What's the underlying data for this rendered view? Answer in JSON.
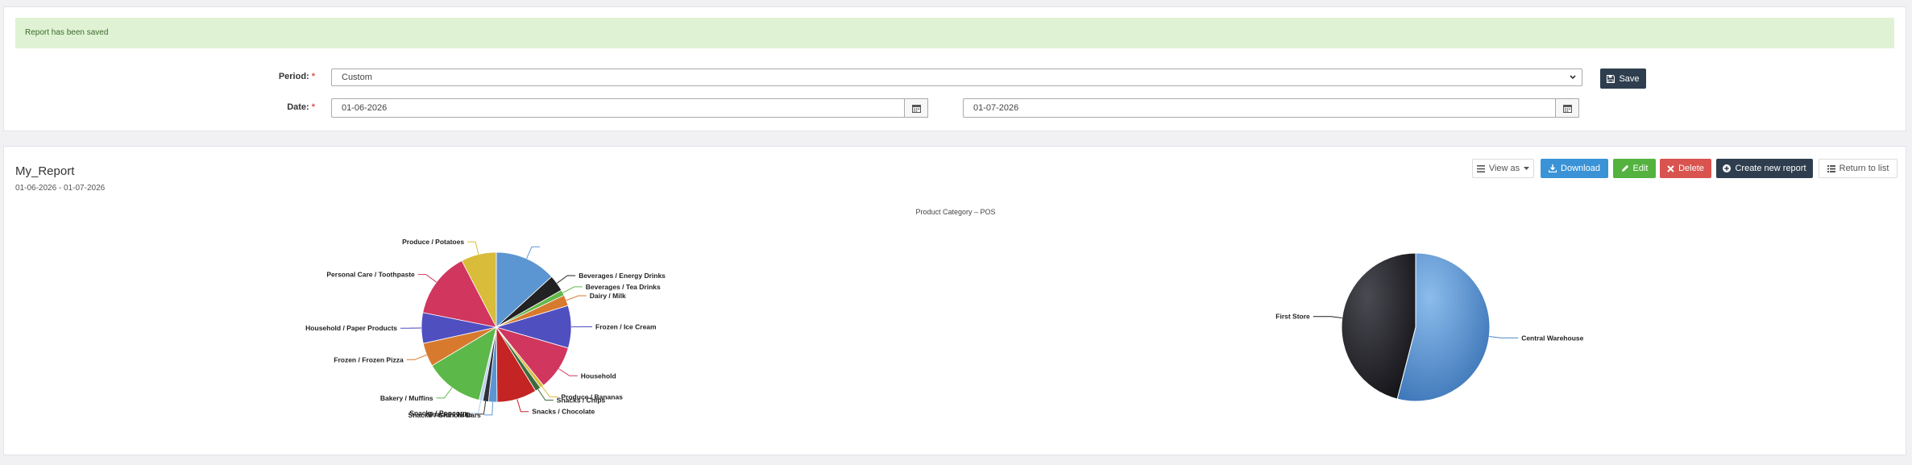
{
  "alert": {
    "message": "Report has been saved"
  },
  "form": {
    "period_label": "Period:",
    "period_value": "Custom",
    "date_label": "Date:",
    "required_mark": "*",
    "date_from": "01-06-2026",
    "date_to": "01-07-2026",
    "save_label": "Save"
  },
  "report": {
    "title": "My_Report",
    "date_range": "01-06-2026 - 01-07-2026",
    "toolbar": {
      "view_as": "View as",
      "download": "Download",
      "edit": "Edit",
      "delete": "Delete",
      "create_new": "Create new report",
      "return_to_list": "Return to list"
    },
    "chart_caption": "Product Category – POS"
  },
  "colors": {
    "alert_bg": "#dff3d4",
    "primary_dark": "#2e3e4e",
    "download_blue": "#3a93d6",
    "edit_green": "#53b33e",
    "delete_red": "#d9534f"
  },
  "chart_data": [
    {
      "type": "pie",
      "slices": [
        {
          "label": "",
          "value": 13.0,
          "color": "#5b95d2"
        },
        {
          "label": "Beverages / Energy Drinks",
          "value": 3.5,
          "color": "#222222"
        },
        {
          "label": "Beverages / Tea Drinks",
          "value": 1.2,
          "color": "#62b84a"
        },
        {
          "label": "Dairy / Milk",
          "value": 2.3,
          "color": "#d77a2e"
        },
        {
          "label": "Frozen / Ice Cream",
          "value": 9.0,
          "color": "#4f4fc0"
        },
        {
          "label": "Household",
          "value": 9.5,
          "color": "#d0365e"
        },
        {
          "label": "Produce / Bananas",
          "value": 0.8,
          "color": "#d8bc3a"
        },
        {
          "label": "Snacks / Chips",
          "value": 1.2,
          "color": "#3d6b3d"
        },
        {
          "label": "Snacks / Chocolate",
          "value": 8.5,
          "color": "#c42424"
        },
        {
          "label": "Snacks / Granola Bars",
          "value": 1.8,
          "color": "#5b95d2"
        },
        {
          "label": "Snacks / Nuts",
          "value": 1.2,
          "color": "#303038"
        },
        {
          "label": "Snacks / Popcorn",
          "value": 0.8,
          "color": "#b8d0ee"
        },
        {
          "label": "Bakery / Muffins",
          "value": 12.5,
          "color": "#5cb848"
        },
        {
          "label": "Frozen / Frozen Pizza",
          "value": 5.0,
          "color": "#d77a2e"
        },
        {
          "label": "Household / Paper Products",
          "value": 6.5,
          "color": "#4f4fc0"
        },
        {
          "label": "Personal Care / Toothpaste",
          "value": 14.0,
          "color": "#d0365e"
        },
        {
          "label": "Produce / Potatoes",
          "value": 7.5,
          "color": "#d8bc3a"
        }
      ]
    },
    {
      "type": "pie",
      "slices": [
        {
          "label": "Central Warehouse",
          "value": 54,
          "color": "#4f86c6"
        },
        {
          "label": "First Store",
          "value": 46,
          "color": "#1f1f23"
        }
      ]
    }
  ]
}
